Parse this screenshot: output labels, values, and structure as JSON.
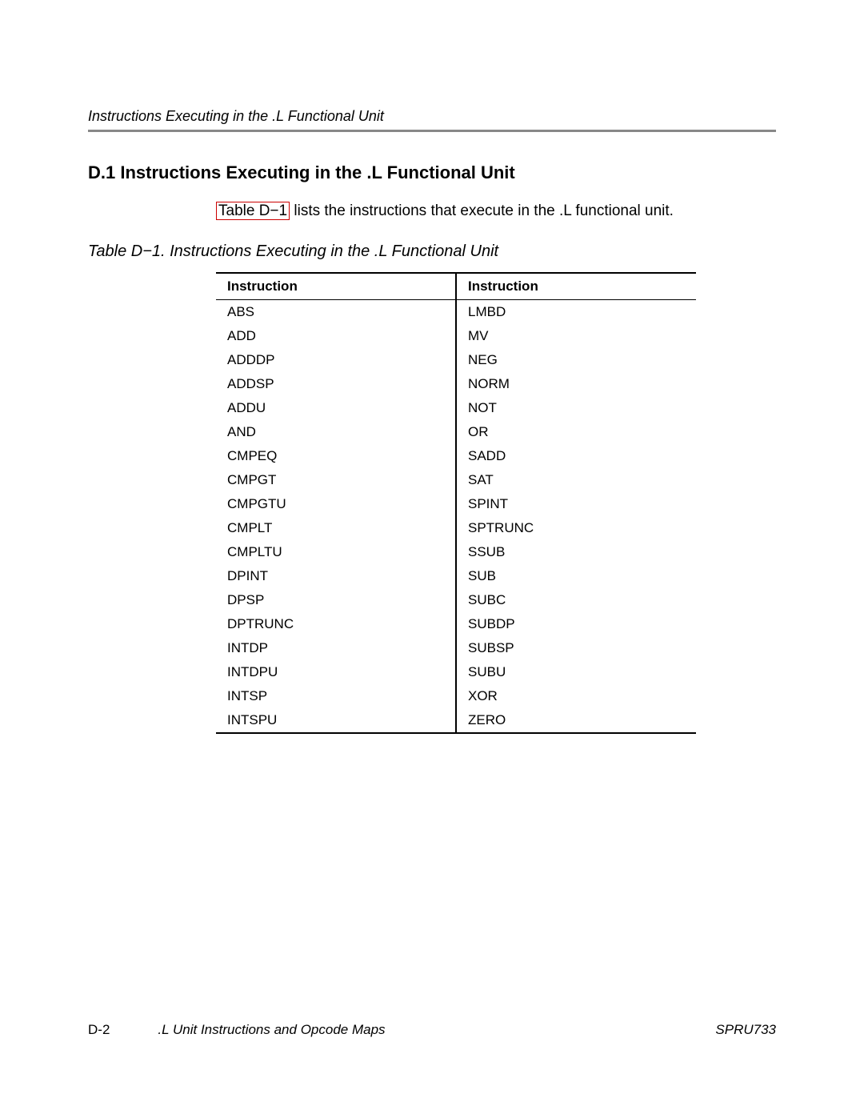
{
  "header": {
    "running": "Instructions Executing in the .L Functional Unit"
  },
  "section": {
    "heading": "D.1  Instructions Executing in the .L Functional Unit",
    "intro_ref": "Table D−1",
    "intro_rest": " lists the instructions that execute in the .L functional unit.",
    "table_caption": "Table D−1. Instructions Executing in the .L Functional Unit"
  },
  "table": {
    "col1_header": "Instruction",
    "col2_header": "Instruction",
    "rows": [
      {
        "c1": "ABS",
        "c2": "LMBD"
      },
      {
        "c1": "ADD",
        "c2": "MV"
      },
      {
        "c1": "ADDDP",
        "c2": "NEG"
      },
      {
        "c1": "ADDSP",
        "c2": "NORM"
      },
      {
        "c1": "ADDU",
        "c2": "NOT"
      },
      {
        "c1": "AND",
        "c2": "OR"
      },
      {
        "c1": "CMPEQ",
        "c2": "SADD"
      },
      {
        "c1": "CMPGT",
        "c2": "SAT"
      },
      {
        "c1": "CMPGTU",
        "c2": "SPINT"
      },
      {
        "c1": "CMPLT",
        "c2": "SPTRUNC"
      },
      {
        "c1": "CMPLTU",
        "c2": "SSUB"
      },
      {
        "c1": "DPINT",
        "c2": "SUB"
      },
      {
        "c1": "DPSP",
        "c2": "SUBC"
      },
      {
        "c1": "DPTRUNC",
        "c2": "SUBDP"
      },
      {
        "c1": "INTDP",
        "c2": "SUBSP"
      },
      {
        "c1": "INTDPU",
        "c2": "SUBU"
      },
      {
        "c1": "INTSP",
        "c2": "XOR"
      },
      {
        "c1": "INTSPU",
        "c2": "ZERO"
      }
    ]
  },
  "footer": {
    "page": "D-2",
    "chapter": ".L Unit Instructions and Opcode Maps",
    "doc_id": "SPRU733"
  }
}
